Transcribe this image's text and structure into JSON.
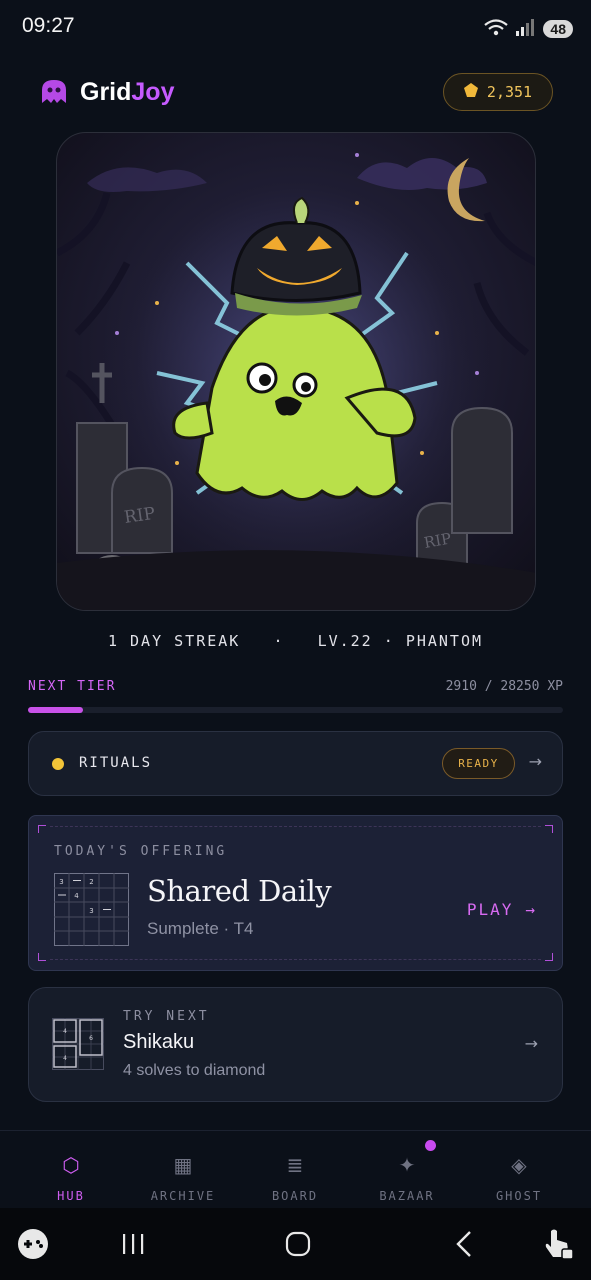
{
  "status_bar": {
    "time": "09:27",
    "battery": "48",
    "signal_label": "5"
  },
  "header": {
    "brand_part1": "Grid",
    "brand_part2": "Joy",
    "coins": "2,351"
  },
  "hero": {
    "grave_text_1": "RIP",
    "grave_text_2": "RIP"
  },
  "profile": {
    "streak": "1 DAY STREAK",
    "level": "LV.22",
    "rank": "PHANTOM",
    "separator": "·"
  },
  "tier": {
    "label": "NEXT TIER",
    "xp_text": "2910 / 28250 XP",
    "progress": 0.103
  },
  "rituals": {
    "label": "RITUALS",
    "badge": "READY",
    "arrow": "→"
  },
  "offering": {
    "label": "TODAY'S OFFERING",
    "title": "Shared Daily",
    "subtitle": "Sumplete · T4",
    "play": "PLAY",
    "arrow": "→",
    "thumb_numbers": [
      "3",
      "2",
      "4",
      "3"
    ]
  },
  "try_next": {
    "label": "TRY NEXT",
    "title": "Shikaku",
    "subtitle": "4 solves to diamond",
    "arrow": "→",
    "thumb_numbers": [
      "4",
      "6",
      "4"
    ]
  },
  "tabs": [
    {
      "label": "HUB",
      "icon": "hexagon-icon",
      "active": true
    },
    {
      "label": "ARCHIVE",
      "icon": "grid-icon",
      "active": false
    },
    {
      "label": "BOARD",
      "icon": "list-icon",
      "active": false
    },
    {
      "label": "BAZAAR",
      "icon": "sparkle-icon",
      "active": false,
      "badge": true
    },
    {
      "label": "GHOST",
      "icon": "diamond-icon",
      "active": false
    }
  ],
  "colors": {
    "accent": "#cf5df0",
    "gold": "#f0c45c",
    "background": "#0b1019",
    "card": "#161c29",
    "ghost_green": "#b9e04a",
    "lightning": "#8fd3e6"
  }
}
